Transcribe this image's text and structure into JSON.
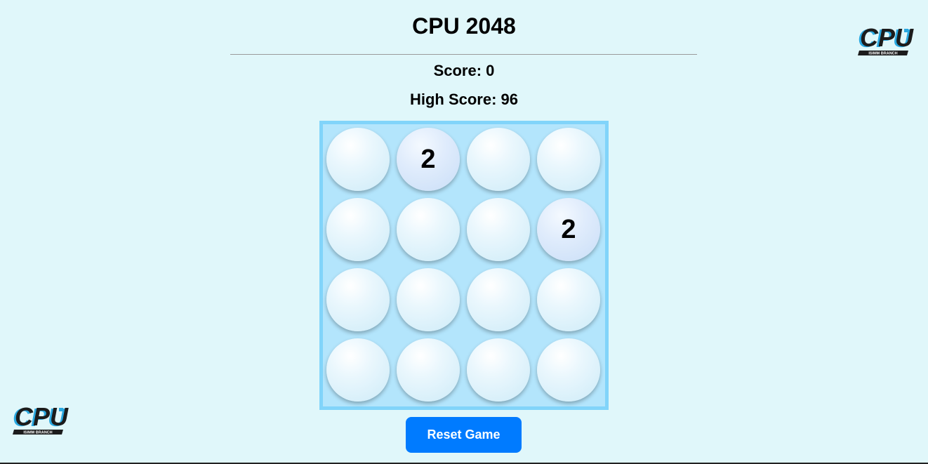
{
  "game": {
    "title": "CPU 2048",
    "score_text": "Score: 0",
    "high_score_text": "High Score: 96",
    "score": 0,
    "high_score": 96
  },
  "board": {
    "size": 4,
    "tiles": [
      [
        null,
        2,
        null,
        null
      ],
      [
        null,
        null,
        null,
        2
      ],
      [
        null,
        null,
        null,
        null
      ],
      [
        null,
        null,
        null,
        null
      ]
    ]
  },
  "controls": {
    "reset_label": "Reset Game"
  },
  "logo": {
    "text": "CPU",
    "subtext": "ISIMM BRANCH",
    "colors": {
      "dark": "#1c1c1c",
      "accent": "#2aa8e0"
    }
  },
  "colors": {
    "background": "#e0f7fa",
    "board_background": "#b3e5fc",
    "board_border": "#81d4fa",
    "button": "#007bff",
    "button_text": "#ffffff"
  }
}
